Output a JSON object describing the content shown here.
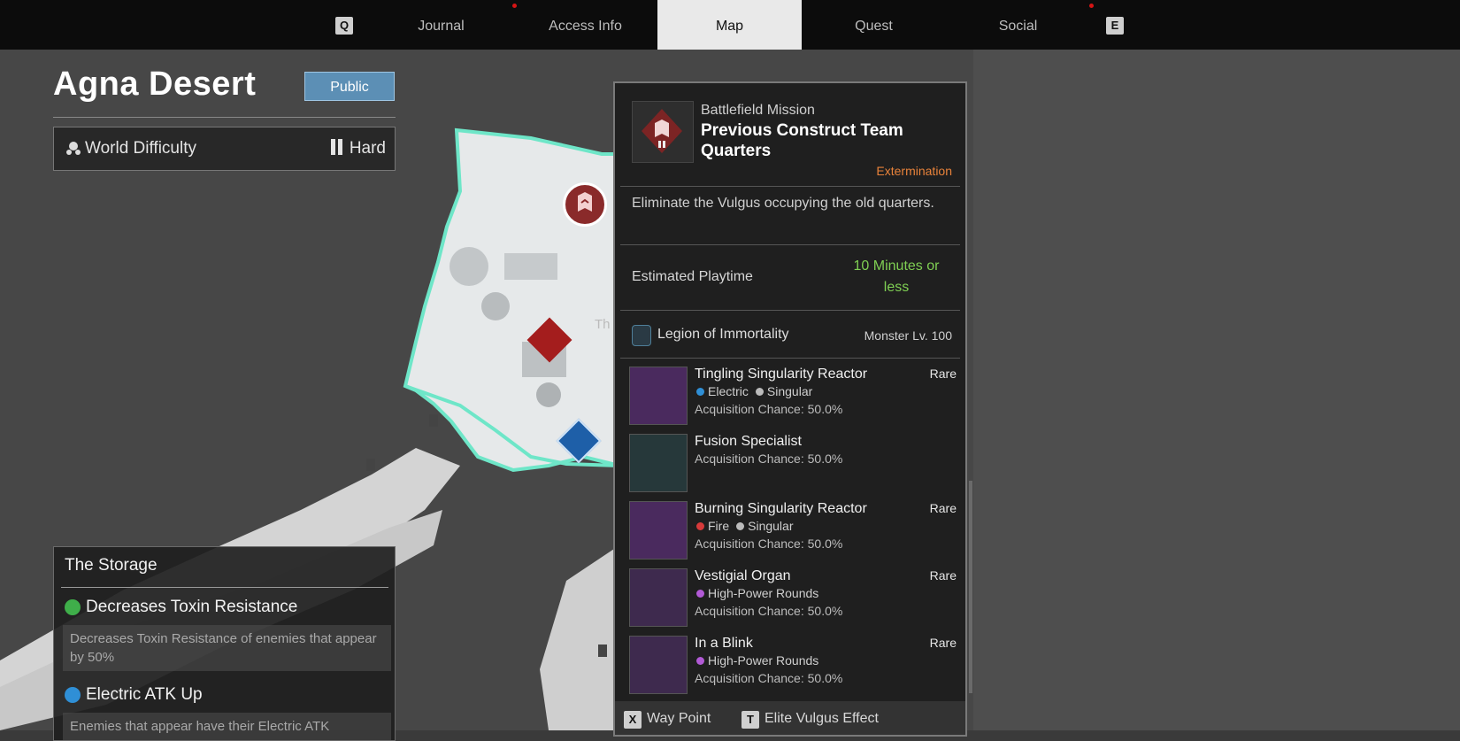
{
  "nav": {
    "left_key": "Q",
    "right_key": "E",
    "tabs": [
      {
        "label": "Journal"
      },
      {
        "label": "Access Info"
      },
      {
        "label": "Map"
      },
      {
        "label": "Quest"
      },
      {
        "label": "Social"
      }
    ],
    "active_tab": "Map"
  },
  "zone": {
    "title": "Agna Desert",
    "visibility_button": "Public",
    "difficulty_label": "World Difficulty",
    "difficulty_value": "Hard"
  },
  "storage": {
    "title": "The Storage",
    "effects": [
      {
        "name": "Decreases Toxin Resistance",
        "desc": "Decreases Toxin Resistance of enemies that appear by 50%",
        "icon": "toxin-icon",
        "color": "#3fae4a"
      },
      {
        "name": "Electric ATK Up",
        "desc": "Enemies that appear have their Electric ATK",
        "icon": "electric-icon",
        "color": "#2f8fd6"
      }
    ]
  },
  "map": {
    "partial_label": "Th"
  },
  "mission": {
    "category": "Battlefield Mission",
    "name": "Previous Construct Team Quarters",
    "type": "Extermination",
    "description": "Eliminate the Vulgus occupying the old quarters.",
    "playtime_label": "Estimated Playtime",
    "playtime_value": "10 Minutes or less",
    "legion": "Legion of Immortality",
    "monster_level": "Monster Lv. 100",
    "rewards": [
      {
        "name": "Tingling Singularity Reactor",
        "rarity": "Rare",
        "tag1": "Electric",
        "tag2": "Singular",
        "chance": "Acquisition Chance: 50.0%"
      },
      {
        "name": "Fusion Specialist",
        "rarity": "",
        "tag1": "",
        "tag2": "",
        "chance": "Acquisition Chance: 50.0%"
      },
      {
        "name": "Burning Singularity Reactor",
        "rarity": "Rare",
        "tag1": "Fire",
        "tag2": "Singular",
        "chance": "Acquisition Chance: 50.0%"
      },
      {
        "name": "Vestigial Organ",
        "rarity": "Rare",
        "tag1": "High-Power Rounds",
        "tag2": "",
        "chance": "Acquisition Chance: 50.0%"
      },
      {
        "name": "In a Blink",
        "rarity": "Rare",
        "tag1": "High-Power Rounds",
        "tag2": "",
        "chance": "Acquisition Chance: 50.0%"
      }
    ],
    "footer": [
      {
        "key": "X",
        "label": "Way Point"
      },
      {
        "key": "T",
        "label": "Elite Vulgus Effect"
      }
    ]
  },
  "colors": {
    "accent_region": "#6ee6c8",
    "public_button": "#5c8fb5",
    "extermination": "#e8823a",
    "playtime": "#7fcf53",
    "notification_dot": "#d61414"
  }
}
